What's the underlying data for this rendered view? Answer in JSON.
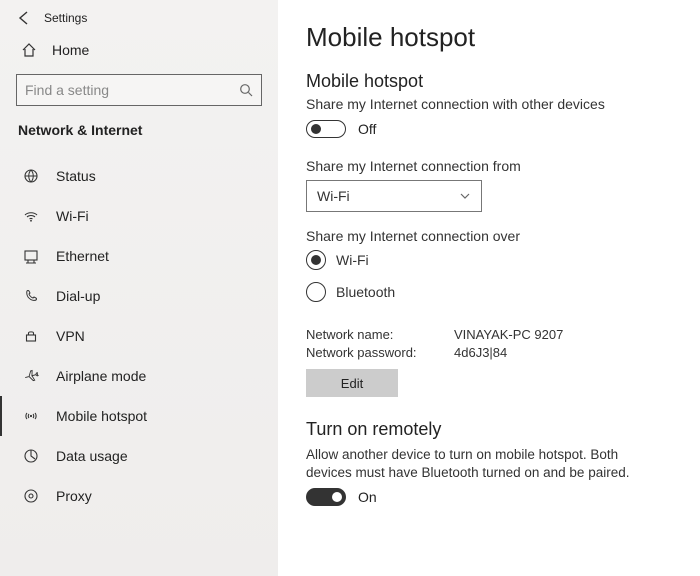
{
  "header": {
    "app_caption": "Settings"
  },
  "home": {
    "label": "Home"
  },
  "search": {
    "placeholder": "Find a setting"
  },
  "sidebar": {
    "category": "Network & Internet",
    "items": [
      {
        "label": "Status"
      },
      {
        "label": "Wi-Fi"
      },
      {
        "label": "Ethernet"
      },
      {
        "label": "Dial-up"
      },
      {
        "label": "VPN"
      },
      {
        "label": "Airplane mode"
      },
      {
        "label": "Mobile hotspot"
      },
      {
        "label": "Data usage"
      },
      {
        "label": "Proxy"
      }
    ]
  },
  "page": {
    "title": "Mobile hotspot",
    "hotspot_section_title": "Mobile hotspot",
    "hotspot_desc": "Share my Internet connection with other devices",
    "hotspot_toggle_state": "Off",
    "share_from_label": "Share my Internet connection from",
    "share_from_value": "Wi-Fi",
    "share_over_label": "Share my Internet connection over",
    "radio_wifi": "Wi-Fi",
    "radio_bt": "Bluetooth",
    "net_name_label": "Network name:",
    "net_name_value": "VINAYAK-PC 9207",
    "net_pw_label": "Network password:",
    "net_pw_value": "4d6J3|84",
    "edit_label": "Edit",
    "remote_title": "Turn on remotely",
    "remote_desc": "Allow another device to turn on mobile hotspot. Both devices must have Bluetooth turned on and be paired.",
    "remote_toggle_state": "On"
  }
}
